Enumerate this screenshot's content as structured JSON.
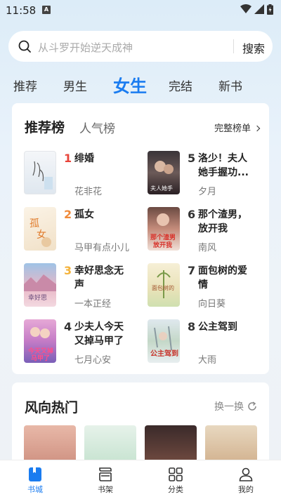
{
  "status": {
    "time": "11:58",
    "notif_icon": "A"
  },
  "search": {
    "placeholder": "从斗罗开始逆天成神",
    "button": "搜索"
  },
  "tabs": [
    {
      "label": "推荐",
      "active": false
    },
    {
      "label": "男生",
      "active": false
    },
    {
      "label": "女生",
      "active": true
    },
    {
      "label": "完结",
      "active": false
    },
    {
      "label": "新书",
      "active": false
    }
  ],
  "ranking": {
    "tab_recommend": "推荐榜",
    "tab_popular": "人气榜",
    "full_list": "完整榜单",
    "books": [
      {
        "rank": "1",
        "title": "绯婚",
        "author": "花非花"
      },
      {
        "rank": "2",
        "title": "孤女",
        "author": "马甲有点小儿"
      },
      {
        "rank": "3",
        "title": "幸好思念无声",
        "author": "一本正经"
      },
      {
        "rank": "4",
        "title": "少夫人今天又掉马甲了",
        "author": "七月心安"
      },
      {
        "rank": "5",
        "title": "洛少！夫人她手握功...",
        "author": "夕月"
      },
      {
        "rank": "6",
        "title": "那个渣男，放开我",
        "author": "南风"
      },
      {
        "rank": "7",
        "title": "面包树的爱情",
        "author": "向日葵"
      },
      {
        "rank": "8",
        "title": "公主驾到",
        "author": "大雨"
      }
    ],
    "rank_colors": {
      "1": "#e8443a",
      "2": "#f08a3a",
      "3": "#f4b33c",
      "other": "#333333"
    }
  },
  "hot": {
    "title": "风向热门",
    "refresh": "换一换"
  },
  "bottom_nav": [
    {
      "label": "书城",
      "icon": "bookstore-icon",
      "active": true
    },
    {
      "label": "书架",
      "icon": "bookshelf-icon",
      "active": false
    },
    {
      "label": "分类",
      "icon": "category-icon",
      "active": false
    },
    {
      "label": "我的",
      "icon": "profile-icon",
      "active": false
    }
  ],
  "colors": {
    "accent": "#1a7cf0"
  }
}
